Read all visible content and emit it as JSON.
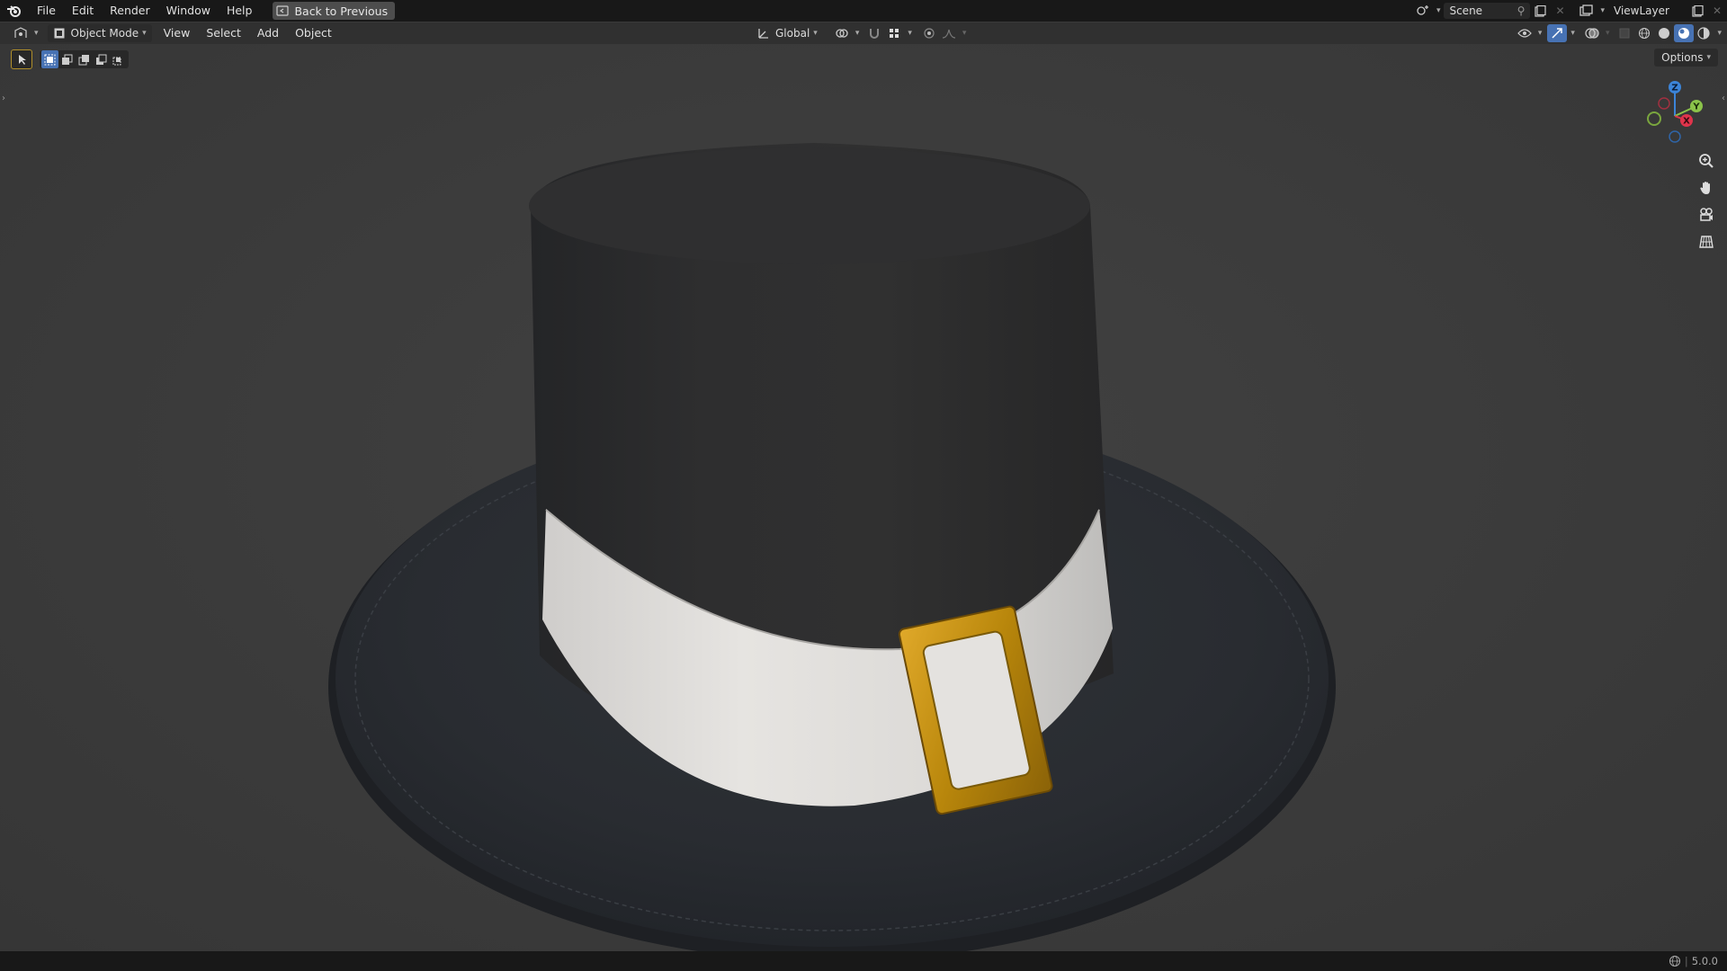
{
  "topbar": {
    "menus": [
      "File",
      "Edit",
      "Render",
      "Window",
      "Help"
    ],
    "back_button": "Back to Previous",
    "scene": "Scene",
    "view_layer": "ViewLayer"
  },
  "header": {
    "mode": "Object Mode",
    "menus": [
      "View",
      "Select",
      "Add",
      "Object"
    ],
    "transform_orientation": "Global"
  },
  "viewport": {
    "options_label": "Options",
    "gizmo_axes": [
      "Z",
      "Y",
      "X"
    ],
    "object": "top hat with white band and gold buckle"
  },
  "statusbar": {
    "version": "5.0.0"
  },
  "colors": {
    "accent": "#4772b3",
    "axis_x": "#e0344b",
    "axis_y": "#8bc34a",
    "axis_z": "#3c84d8",
    "buckle_gold": "#b8860b"
  }
}
